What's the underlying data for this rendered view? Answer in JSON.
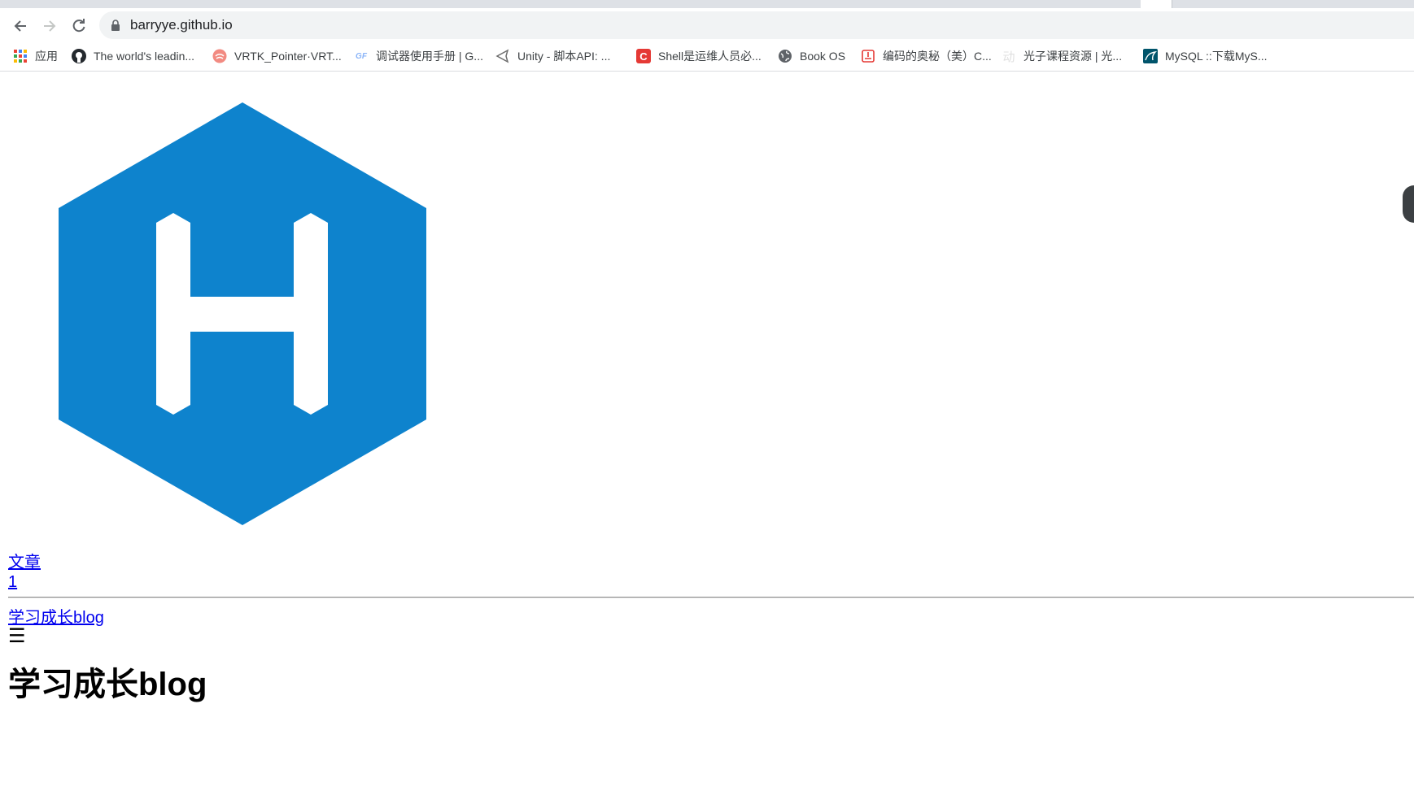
{
  "browser": {
    "url": "barryye.github.io",
    "bookmarks": [
      {
        "label": "应用",
        "icon": "apps-grid-icon"
      },
      {
        "label": "The world's leadin...",
        "icon": "github-icon"
      },
      {
        "label": "VRTK_Pointer·VRT...",
        "icon": "vrtk-icon"
      },
      {
        "label": "调试器使用手册 | G...",
        "icon": "gf-icon"
      },
      {
        "label": "Unity - 脚本API: ...",
        "icon": "unity-icon"
      },
      {
        "label": "Shell是运维人员必...",
        "icon": "csdn-icon"
      },
      {
        "label": "Book OS",
        "icon": "globe-icon"
      },
      {
        "label": "编码的奥秘（美）C...",
        "icon": "book-icon"
      },
      {
        "label": "光子课程资源 | 光...",
        "icon": "photon-icon"
      },
      {
        "label": "MySQL ::下载MyS...",
        "icon": "mysql-icon"
      }
    ]
  },
  "page": {
    "logo_letter": "H",
    "articles_label": "文章",
    "articles_count": "1",
    "site_link": "学习成长blog",
    "menu_icon": "☰",
    "site_title": "学习成长blog"
  },
  "colors": {
    "logo_blue": "#0e83cd",
    "link": "#0000ee"
  }
}
